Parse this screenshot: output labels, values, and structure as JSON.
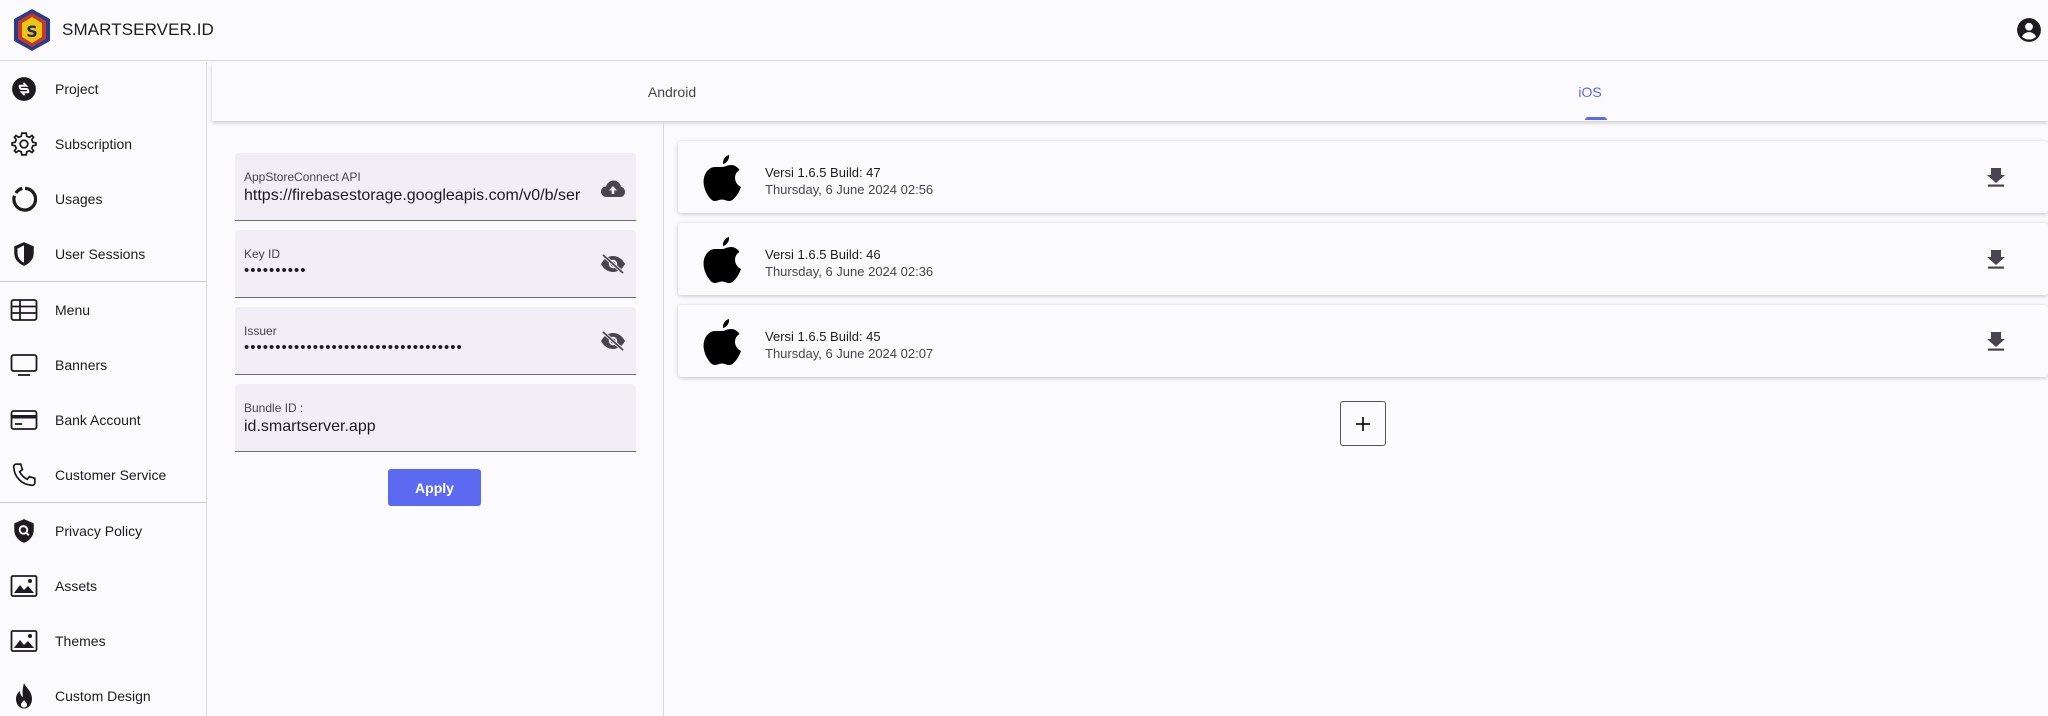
{
  "header": {
    "brand": "SMARTSERVER.ID"
  },
  "sidebar": {
    "items": [
      {
        "label": "Project",
        "icon": "project-icon"
      },
      {
        "label": "Subscription",
        "icon": "gear-icon"
      },
      {
        "label": "Usages",
        "icon": "usage-ring-icon"
      },
      {
        "label": "User Sessions",
        "icon": "shield-icon"
      },
      {
        "label": "Menu",
        "icon": "table-icon"
      },
      {
        "label": "Banners",
        "icon": "monitor-icon"
      },
      {
        "label": "Bank Account",
        "icon": "card-icon"
      },
      {
        "label": "Customer Service",
        "icon": "phone-icon"
      },
      {
        "label": "Privacy Policy",
        "icon": "shield-search-icon"
      },
      {
        "label": "Assets",
        "icon": "image-icon"
      },
      {
        "label": "Themes",
        "icon": "image-icon"
      },
      {
        "label": "Custom Design",
        "icon": "flame-icon"
      }
    ]
  },
  "tabs": {
    "android": "Android",
    "ios": "iOS",
    "active": "iOS"
  },
  "form": {
    "appstore": {
      "label": "AppStoreConnect API",
      "value": "https://firebasestorage.googleapis.com/v0/b/ser"
    },
    "key_id": {
      "label": "Key ID",
      "value": "••••••••••"
    },
    "issuer": {
      "label": "Issuer",
      "value": "•••••••••••••••••••••••••••••••••••"
    },
    "bundle": {
      "label": "Bundle ID :",
      "value": "id.smartserver.app"
    },
    "apply_label": "Apply"
  },
  "builds": [
    {
      "version": "Versi 1.6.5 Build: 47",
      "date": "Thursday, 6 June 2024 02:56"
    },
    {
      "version": "Versi 1.6.5 Build: 46",
      "date": "Thursday, 6 June 2024 02:36"
    },
    {
      "version": "Versi 1.6.5 Build: 45",
      "date": "Thursday, 6 June 2024 02:07"
    }
  ],
  "colors": {
    "accent": "#5b6af0",
    "field_bg": "#f1eef5",
    "background": "#fbfafc"
  }
}
